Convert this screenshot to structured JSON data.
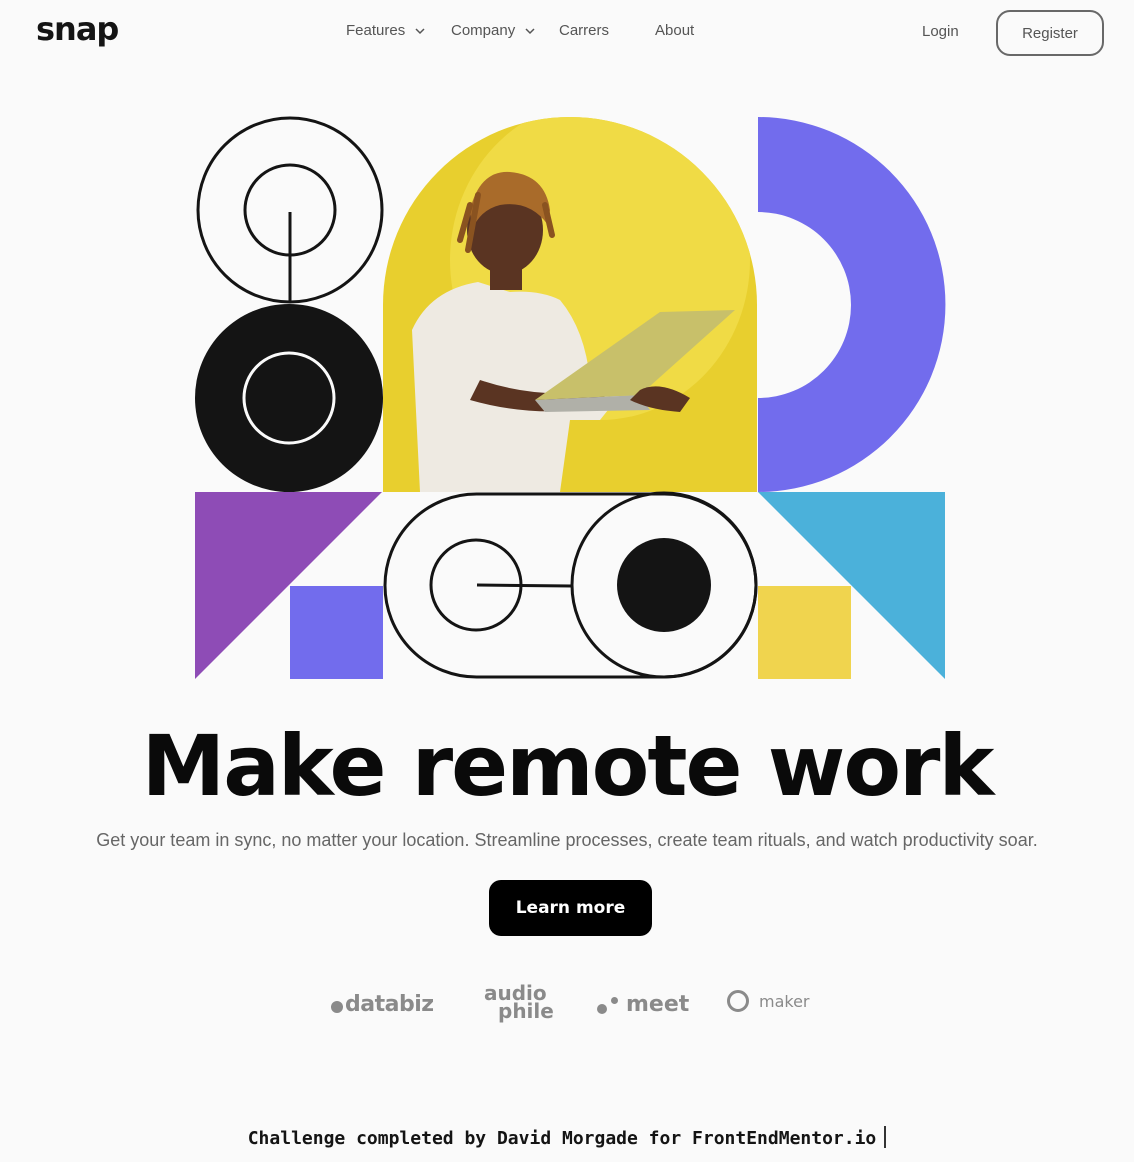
{
  "header": {
    "logo": "snap",
    "nav": [
      {
        "label": "Features",
        "has_dropdown": true
      },
      {
        "label": "Company",
        "has_dropdown": true
      },
      {
        "label": "Carrers",
        "has_dropdown": false
      },
      {
        "label": "About",
        "has_dropdown": false
      }
    ],
    "login": "Login",
    "register": "Register"
  },
  "hero": {
    "title": "Make remote work",
    "subtitle": "Get your team in sync, no matter your location. Streamline processes, create team rituals, and watch productivity soar.",
    "cta": "Learn more"
  },
  "clients": {
    "databiz": "databiz",
    "audiophile_top": "audio",
    "audiophile_bottom": "phile",
    "meet": "meet",
    "maker": "maker"
  },
  "footer": {
    "credit": "Challenge completed by David Morgade for FrontEndMentor.io"
  },
  "colors": {
    "background": "#fafafa",
    "purple": "#726ced",
    "violet": "#8e4cb6",
    "sky": "#4bb1da",
    "yellow": "#f0d44e",
    "photo_bg": "#e8cf2e",
    "ink": "#141414"
  }
}
